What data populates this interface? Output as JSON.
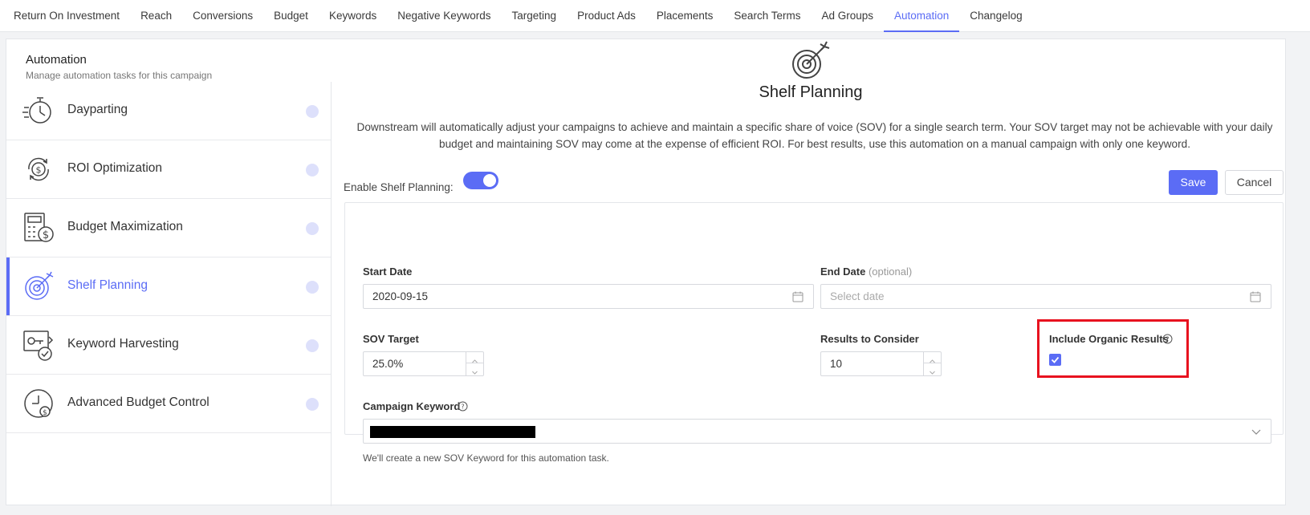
{
  "tabs": [
    {
      "label": "Return On Investment"
    },
    {
      "label": "Reach"
    },
    {
      "label": "Conversions"
    },
    {
      "label": "Budget"
    },
    {
      "label": "Keywords"
    },
    {
      "label": "Negative Keywords"
    },
    {
      "label": "Targeting"
    },
    {
      "label": "Product Ads"
    },
    {
      "label": "Placements"
    },
    {
      "label": "Search Terms"
    },
    {
      "label": "Ad Groups"
    },
    {
      "label": "Automation",
      "active": true
    },
    {
      "label": "Changelog"
    }
  ],
  "card": {
    "title": "Automation",
    "subtitle": "Manage automation tasks for this campaign"
  },
  "sidebar": {
    "items": [
      {
        "label": "Dayparting",
        "icon": "stopwatch-icon"
      },
      {
        "label": "ROI Optimization",
        "icon": "dollar-cycle-icon"
      },
      {
        "label": "Budget Maximization",
        "icon": "calculator-dollar-icon"
      },
      {
        "label": "Shelf Planning",
        "icon": "target-arrow-icon",
        "active": true
      },
      {
        "label": "Keyword Harvesting",
        "icon": "key-check-icon"
      },
      {
        "label": "Advanced Budget Control",
        "icon": "clock-dollar-icon"
      }
    ]
  },
  "main": {
    "title": "Shelf Planning",
    "icon": "target-arrow-icon",
    "description": "Downstream will automatically adjust your campaigns to achieve and maintain a specific share of voice (SOV) for a single search term. Your SOV target may not be achievable with your daily budget and maintaining SOV may come at the expense of efficient ROI. For best results, use this automation on a manual campaign with only one keyword.",
    "enable_label": "Enable Shelf Planning:",
    "enabled": true,
    "save_label": "Save",
    "cancel_label": "Cancel"
  },
  "form": {
    "start_date_label": "Start Date",
    "start_date_value": "2020-09-15",
    "end_date_label": "End Date",
    "end_date_optional": "(optional)",
    "end_date_placeholder": "Select date",
    "sov_target_label": "SOV Target",
    "sov_target_value": "25.0%",
    "results_label": "Results to Consider",
    "results_value": "10",
    "organic_label": "Include Organic Results",
    "organic_checked": true,
    "keyword_label": "Campaign Keyword",
    "keyword_hint": "We'll create a new SOV Keyword for this automation task."
  },
  "colors": {
    "accent": "#5b6cf5",
    "highlight": "#e8121f"
  }
}
